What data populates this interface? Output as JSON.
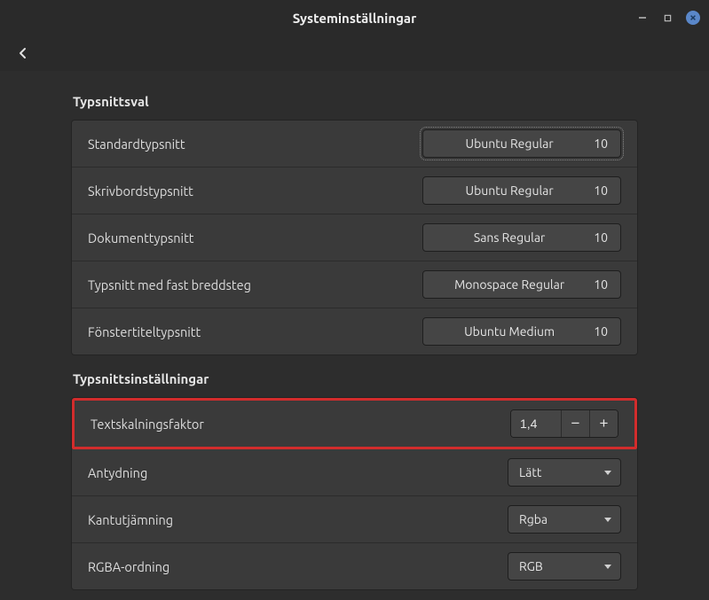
{
  "window": {
    "title": "Systeminställningar"
  },
  "sections": {
    "fonts": {
      "title": "Typsnittsval",
      "rows": {
        "standard": {
          "label": "Standardtypsnitt",
          "font": "Ubuntu Regular",
          "size": "10"
        },
        "desktop": {
          "label": "Skrivbordstypsnitt",
          "font": "Ubuntu Regular",
          "size": "10"
        },
        "document": {
          "label": "Dokumenttypsnitt",
          "font": "Sans Regular",
          "size": "10"
        },
        "mono": {
          "label": "Typsnitt med fast breddsteg",
          "font": "Monospace Regular",
          "size": "10"
        },
        "title": {
          "label": "Fönstertiteltypsnitt",
          "font": "Ubuntu Medium",
          "size": "10"
        }
      }
    },
    "settings": {
      "title": "Typsnittsinställningar",
      "rows": {
        "scale": {
          "label": "Textskalningsfaktor",
          "value": "1,4"
        },
        "hinting": {
          "label": "Antydning",
          "value": "Lätt"
        },
        "antialias": {
          "label": "Kantutjämning",
          "value": "Rgba"
        },
        "rgba": {
          "label": "RGBA-ordning",
          "value": "RGB"
        }
      }
    }
  }
}
